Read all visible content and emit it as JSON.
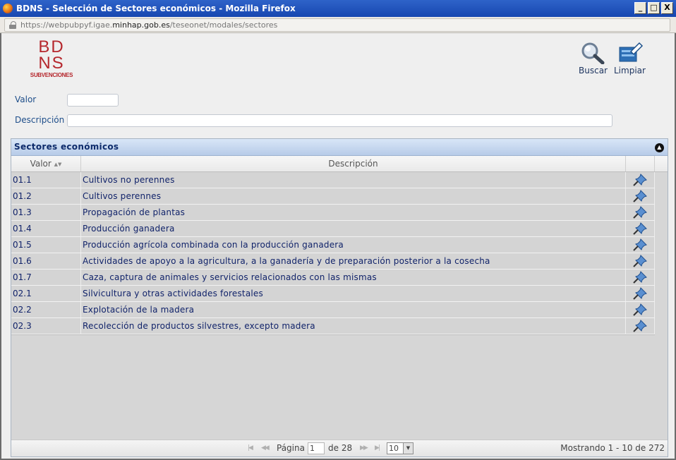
{
  "window": {
    "title": "BDNS - Selección de Sectores económicos - Mozilla Firefox",
    "min": "_",
    "max": "□",
    "close": "X"
  },
  "url": {
    "prefix": "https://webpubpyf.igae.",
    "domain": "minhap.gob.es",
    "path": "/teseonet/modales/sectores"
  },
  "logo": {
    "line1": "BD",
    "line2": "NS",
    "tagline": "SUBVENCIONES"
  },
  "toolbar": {
    "buscar_label": "Buscar",
    "limpiar_label": "Limpiar"
  },
  "form": {
    "valor_label": "Valor",
    "valor_value": "",
    "descripcion_label": "Descripción",
    "descripcion_value": ""
  },
  "grid": {
    "caption": "Sectores económicos",
    "col_valor": "Valor",
    "col_descripcion": "Descripción",
    "rows": [
      {
        "valor": "01.1",
        "descripcion": "Cultivos no perennes"
      },
      {
        "valor": "01.2",
        "descripcion": "Cultivos perennes"
      },
      {
        "valor": "01.3",
        "descripcion": "Propagación de plantas"
      },
      {
        "valor": "01.4",
        "descripcion": "Producción ganadera"
      },
      {
        "valor": "01.5",
        "descripcion": "Producción agrícola combinada con la producción ganadera"
      },
      {
        "valor": "01.6",
        "descripcion": "Actividades de apoyo a la agricultura, a la ganadería y de preparación posterior a la cosecha"
      },
      {
        "valor": "01.7",
        "descripcion": "Caza, captura de animales y servicios relacionados con las mismas"
      },
      {
        "valor": "02.1",
        "descripcion": "Silvicultura y otras actividades forestales"
      },
      {
        "valor": "02.2",
        "descripcion": "Explotación de la madera"
      },
      {
        "valor": "02.3",
        "descripcion": "Recolección de productos silvestres, excepto madera"
      }
    ]
  },
  "pager": {
    "page_label": "Página",
    "page_value": "1",
    "of_label": "de 28",
    "page_size": "10",
    "info": "Mostrando 1 - 10 de 272"
  },
  "colors": {
    "title_bar": "#1747b0",
    "logo_red": "#b5272d",
    "link_blue": "#11236a"
  }
}
